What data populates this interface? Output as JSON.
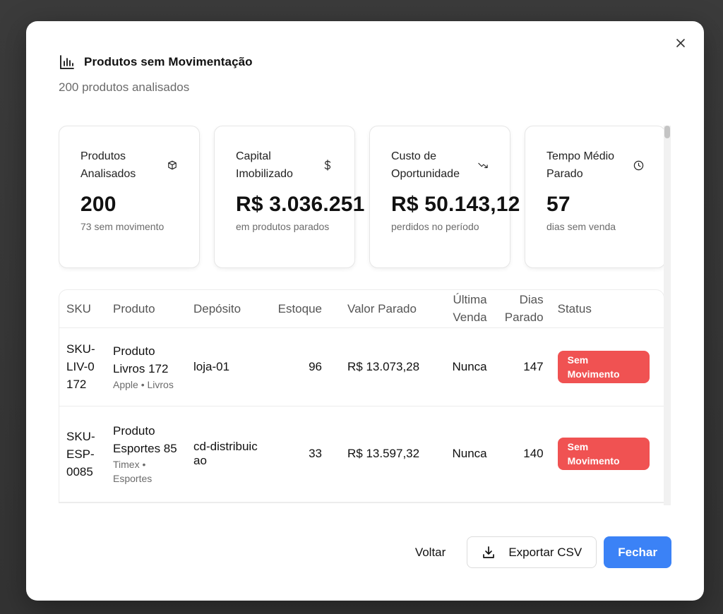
{
  "modal": {
    "title": "Produtos sem Movimentação",
    "subtitle": "200 produtos analisados",
    "close_icon": "close-icon",
    "title_icon": "bar-chart-icon"
  },
  "cards": [
    {
      "label": "Produtos Analisados",
      "value": "200",
      "note": "73 sem movimento",
      "icon": "box-icon"
    },
    {
      "label": "Capital Imobilizado",
      "value": "R$ 3.036.251",
      "note": "em produtos parados",
      "icon": "dollar-icon"
    },
    {
      "label": "Custo de Oportunidade",
      "value": "R$ 50.143,12",
      "note": "perdidos no período",
      "icon": "trending-down-icon"
    },
    {
      "label": "Tempo Médio Parado",
      "value": "57",
      "note": "dias sem venda",
      "icon": "clock-icon"
    }
  ],
  "table": {
    "headers": {
      "sku": "SKU",
      "produto": "Produto",
      "deposito": "Depósito",
      "estoque": "Estoque",
      "valor": "Valor Parado",
      "ultima": "Última Venda",
      "dias": "Dias Parado",
      "status": "Status"
    },
    "rows": [
      {
        "sku": "SKU-LIV-0172",
        "produto": "Produto Livros 172",
        "meta": "Apple • Livros",
        "deposito": "loja-01",
        "estoque": "96",
        "valor": "R$ 13.073,28",
        "ultima": "Nunca",
        "dias": "147",
        "status": "Sem Movimento"
      },
      {
        "sku": "SKU-ESP-0085",
        "produto": "Produto Esportes 85",
        "meta": "Timex • Esportes",
        "deposito": "cd-distribuicao",
        "estoque": "33",
        "valor": "R$ 13.597,32",
        "ultima": "Nunca",
        "dias": "140",
        "status": "Sem Movimento"
      }
    ]
  },
  "footer": {
    "back_label": "Voltar",
    "export_label": "Exportar CSV",
    "close_label": "Fechar"
  },
  "colors": {
    "primary": "#3b82f6",
    "danger": "#f05252"
  }
}
